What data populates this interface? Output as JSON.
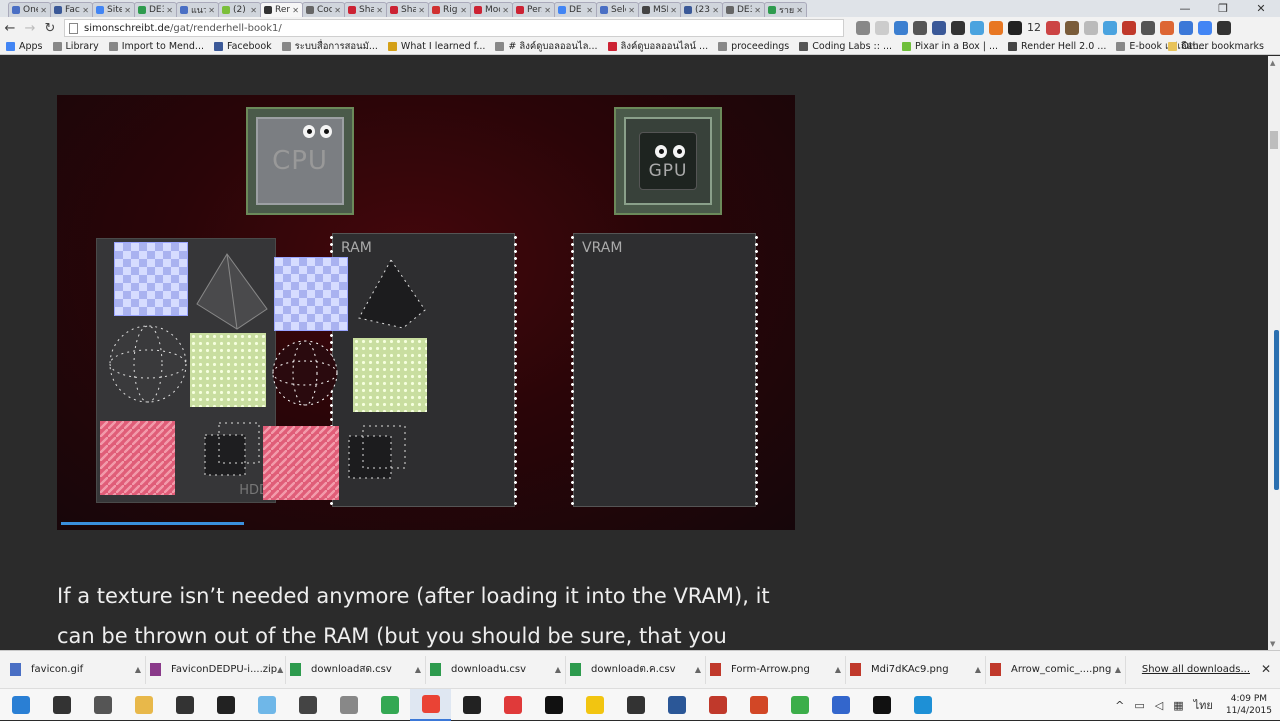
{
  "browser": {
    "tabs": [
      {
        "label": "One",
        "color": "#4a6fc4"
      },
      {
        "label": "Face",
        "color": "#3b5998"
      },
      {
        "label": "Site",
        "color": "#4285f4"
      },
      {
        "label": "DE3",
        "color": "#2e9b4e"
      },
      {
        "label": "แนวท",
        "color": "#4a6fc4"
      },
      {
        "label": "(2) 1",
        "color": "#7bbf3a"
      },
      {
        "label": "Renc",
        "color": "#333333",
        "active": true
      },
      {
        "label": "Codi",
        "color": "#666666"
      },
      {
        "label": "Shac",
        "color": "#cc2233"
      },
      {
        "label": "Shac",
        "color": "#cc2233"
      },
      {
        "label": "Righ",
        "color": "#d03030"
      },
      {
        "label": "Mod",
        "color": "#cc2233"
      },
      {
        "label": "Pers",
        "color": "#cc2233"
      },
      {
        "label": "DE",
        "color": "#4285f4"
      },
      {
        "label": "Sele",
        "color": "#4a6fc4"
      },
      {
        "label": "MSN",
        "color": "#444444"
      },
      {
        "label": "(23)",
        "color": "#3b5998"
      },
      {
        "label": "DE3",
        "color": "#666666"
      },
      {
        "label": "รายชื่",
        "color": "#2e9b4e"
      }
    ],
    "window_controls": [
      "—",
      "❐",
      "✕"
    ],
    "url_domain": "simonschreibt.de",
    "url_path": "/gat/renderhell-book1/",
    "toolbar_icon_colors": [
      "#888888",
      "#cccccc",
      "#3c7fd0",
      "#555555",
      "#3b5998",
      "#333333",
      "#4aa3df",
      "#e87722",
      "#222222",
      "#cc4444",
      "#7a5c3a",
      "#bbbbbb",
      "#4aa3df",
      "#c0392b",
      "#555555",
      "#dd6633",
      "#3b78d8",
      "#4285f4",
      "#333333"
    ],
    "toolbar_number": "12",
    "bookmarks": [
      {
        "label": "Apps",
        "color": "#4285f4"
      },
      {
        "label": "Library",
        "color": "#888888"
      },
      {
        "label": "Import to Mend...",
        "color": "#888888"
      },
      {
        "label": "Facebook",
        "color": "#3b5998"
      },
      {
        "label": "ระบบสื่อการสอนมั...",
        "color": "#888888"
      },
      {
        "label": "What I learned f...",
        "color": "#d4a017"
      },
      {
        "label": "# ลิงค์ดูบอลออนไล...",
        "color": "#888888"
      },
      {
        "label": "ลิงค์ดูบอลออนไลน์ ...",
        "color": "#cc2233"
      },
      {
        "label": "proceedings",
        "color": "#888888"
      },
      {
        "label": "Coding Labs :: ...",
        "color": "#555555"
      },
      {
        "label": "Pixar in a Box | ...",
        "color": "#6fbf3a"
      },
      {
        "label": "Render Hell 2.0 ...",
        "color": "#444444"
      },
      {
        "label": "E-book แค่เลือบ...",
        "color": "#888888"
      }
    ],
    "bookmarks_more": "»",
    "other_bookmarks": "Other bookmarks"
  },
  "figure": {
    "cpu_label": "CPU",
    "gpu_label": "GPU",
    "ram_label": "RAM",
    "vram_label": "VRAM",
    "hdd_label": "HDD",
    "progress": 0.25
  },
  "article": {
    "paragraph": "If a texture isn’t needed anymore (after loading it into the VRAM), it can be thrown out of the RAM (but you should be sure, that you"
  },
  "downloads": {
    "items": [
      {
        "name": "favicon.gif",
        "color": "#4a6fc4"
      },
      {
        "name": "FaviconDEDPU-i....zip",
        "color": "#8a3a8a"
      },
      {
        "name": "downloadสด.csv",
        "color": "#2e9b4e"
      },
      {
        "name": "downloadน.csv",
        "color": "#2e9b4e"
      },
      {
        "name": "downloadต.ค.csv",
        "color": "#2e9b4e"
      },
      {
        "name": "Form-Arrow.png",
        "color": "#c0392b"
      },
      {
        "name": "Mdi7dKAc9.png",
        "color": "#c0392b"
      },
      {
        "name": "Arrow_comic_....png",
        "color": "#c0392b"
      }
    ],
    "show_all": "Show all downloads...",
    "close": "✕"
  },
  "taskbar": {
    "apps": [
      {
        "name": "start",
        "color": "#2a7fd4"
      },
      {
        "name": "search",
        "color": "#333333"
      },
      {
        "name": "task-view",
        "color": "#555555"
      },
      {
        "name": "file-explorer",
        "color": "#e8b84a"
      },
      {
        "name": "store",
        "color": "#333333"
      },
      {
        "name": "epic-games",
        "color": "#222222"
      },
      {
        "name": "app-blue",
        "color": "#6fb7e8"
      },
      {
        "name": "calculator",
        "color": "#444444"
      },
      {
        "name": "app-gray",
        "color": "#888888"
      },
      {
        "name": "chrome-alt",
        "color": "#34a853"
      },
      {
        "name": "chrome",
        "color": "#ea4335",
        "active": true
      },
      {
        "name": "unity",
        "color": "#222222"
      },
      {
        "name": "app-red",
        "color": "#e03a3a"
      },
      {
        "name": "vpt",
        "color": "#111111"
      },
      {
        "name": "sticky",
        "color": "#f2c511"
      },
      {
        "name": "unity-2",
        "color": "#333333"
      },
      {
        "name": "word",
        "color": "#2b5797"
      },
      {
        "name": "app-c",
        "color": "#c0392b"
      },
      {
        "name": "powerpoint",
        "color": "#d24726"
      },
      {
        "name": "camtasia",
        "color": "#3cae4a"
      },
      {
        "name": "flag",
        "color": "#3366cc"
      },
      {
        "name": "terminal",
        "color": "#111111"
      },
      {
        "name": "ie",
        "color": "#1e90d6"
      }
    ],
    "tray_icons": [
      "^",
      "▭",
      "◁",
      "▦"
    ],
    "language": "ไทย",
    "time": "4:09 PM",
    "date": "11/4/2015"
  }
}
